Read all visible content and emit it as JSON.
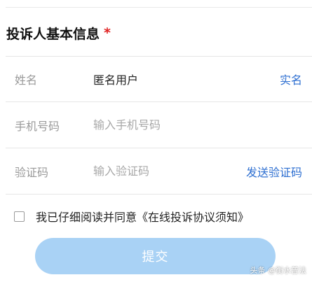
{
  "section": {
    "title": "投诉人基本信息",
    "required_mark": "*"
  },
  "form": {
    "name": {
      "label": "姓名",
      "value": "匿名用户",
      "action": "实名"
    },
    "phone": {
      "label": "手机号码",
      "placeholder": "输入手机号码"
    },
    "code": {
      "label": "验证码",
      "placeholder": "输入验证码",
      "action": "发送验证码"
    }
  },
  "agreement": {
    "text": "我已仔细阅读并同意《在线投诉协议须知》",
    "checked": false
  },
  "submit": {
    "label": "提交"
  },
  "watermark": {
    "text": "头条 @衡水普法"
  },
  "colors": {
    "accent": "#2e6fd1",
    "required": "#e02020",
    "submit_bg": "#a9d2f5"
  }
}
